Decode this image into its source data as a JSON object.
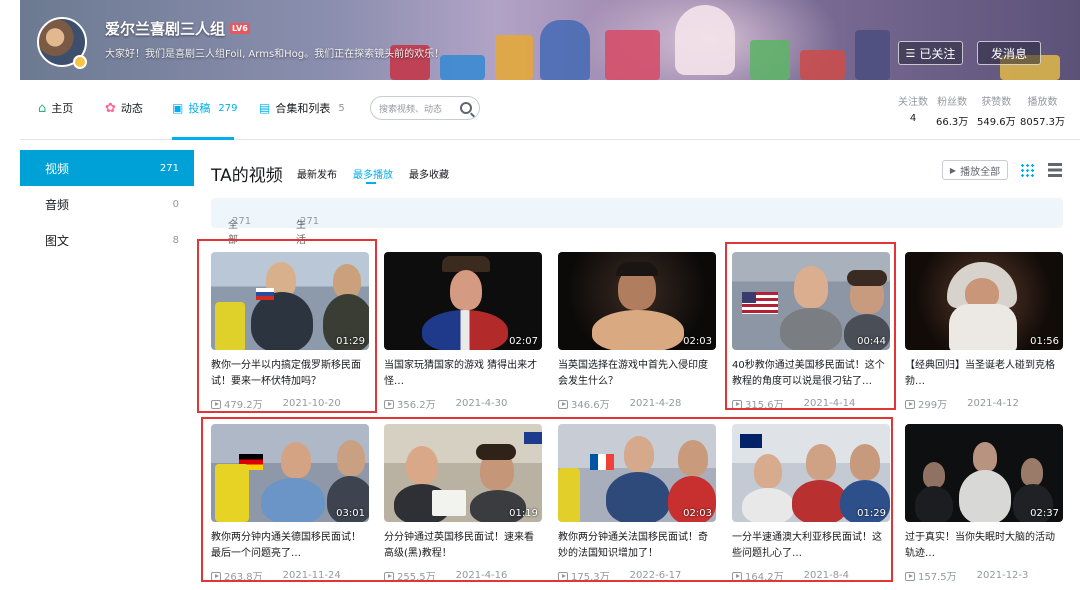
{
  "header": {
    "username": "爱尔兰喜剧三人组",
    "level": "LV6",
    "signature": "大家好！我们是喜剧三人组Foil, Arms和Hog。我们正在探索镜头前的欢乐！",
    "followed_label": "已关注",
    "message_label": "发消息"
  },
  "nav": {
    "tabs": [
      {
        "label": "主页",
        "count": ""
      },
      {
        "label": "动态",
        "count": ""
      },
      {
        "label": "投稿",
        "count": "279"
      },
      {
        "label": "合集和列表",
        "count": "5"
      }
    ],
    "search_placeholder": "搜索视频、动态",
    "stats": [
      {
        "label": "关注数",
        "value": "4"
      },
      {
        "label": "粉丝数",
        "value": "66.3万"
      },
      {
        "label": "获赞数",
        "value": "549.6万"
      },
      {
        "label": "播放数",
        "value": "8057.3万"
      }
    ]
  },
  "sidebar": {
    "items": [
      {
        "label": "视频",
        "count": "271"
      },
      {
        "label": "音频",
        "count": "0"
      },
      {
        "label": "图文",
        "count": "8"
      }
    ]
  },
  "main": {
    "title": "TA的视频",
    "sorts": [
      "最新发布",
      "最多播放",
      "最多收藏"
    ],
    "play_all_label": "播放全部",
    "filters": [
      {
        "label": "全部",
        "count": "271"
      },
      {
        "label": "生活",
        "count": "271"
      }
    ]
  },
  "videos": [
    {
      "title": "教你一分半以内搞定俄罗斯移民面试！要来一杯伏特加吗？",
      "duration": "01:29",
      "views": "479.2万",
      "date": "2021-10-20"
    },
    {
      "title": "当国家玩猜国家的游戏 猜得出来才怪…",
      "duration": "02:07",
      "views": "356.2万",
      "date": "2021-4-30"
    },
    {
      "title": "当英国选择在游戏中首先入侵印度会发生什么？",
      "duration": "02:03",
      "views": "346.6万",
      "date": "2021-4-28"
    },
    {
      "title": "40秒教你通过美国移民面试！这个教程的角度可以说是很刁钻了…",
      "duration": "00:44",
      "views": "315.6万",
      "date": "2021-4-14"
    },
    {
      "title": "【经典回归】当圣诞老人碰到克格勃…",
      "duration": "01:56",
      "views": "299万",
      "date": "2021-4-12"
    },
    {
      "title": "教你两分钟内通关德国移民面试！最后一个问题亮了…",
      "duration": "03:01",
      "views": "263.8万",
      "date": "2021-11-24"
    },
    {
      "title": "分分钟通过英国移民面试！速来看高级(黑)教程！",
      "duration": "01:19",
      "views": "255.5万",
      "date": "2021-4-16"
    },
    {
      "title": "教你两分钟通关法国移民面试！奇妙的法国知识增加了！",
      "duration": "02:03",
      "views": "175.3万",
      "date": "2022-6-17"
    },
    {
      "title": "一分半速通澳大利亚移民面试！这些问题扎心了…",
      "duration": "01:29",
      "views": "164.2万",
      "date": "2021-8-4"
    },
    {
      "title": "过于真实！当你失眠时大脑的活动轨迹…",
      "duration": "02:37",
      "views": "157.5万",
      "date": "2021-12-3"
    }
  ],
  "colors": {
    "accent": "#00aeec",
    "sidebar_active": "#00a1d6",
    "highlight_box": "#e33535"
  }
}
